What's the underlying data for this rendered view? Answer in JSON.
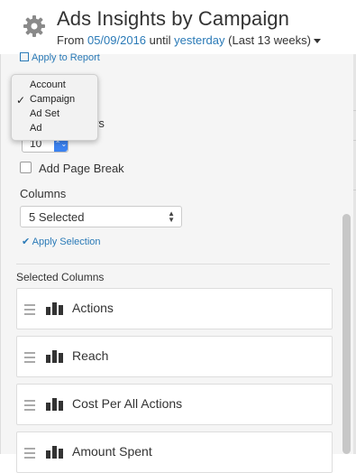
{
  "header": {
    "title": "Ads Insights by Campaign",
    "range_prefix": "From",
    "start_date": "05/09/2016",
    "until_text": "until",
    "end_text": "yesterday",
    "period_text": "(Last 13 weeks)",
    "icon": "gear-icon"
  },
  "panel": {
    "apply_report_label": "Apply to Report",
    "clipped_label": "ws",
    "rows_value": "10",
    "page_break_label": "Add Page Break",
    "columns_label": "Columns",
    "columns_selected": "5 Selected",
    "apply_selection_label": "Apply Selection",
    "selected_columns_title": "Selected Columns",
    "selected_columns": [
      {
        "name": "Actions"
      },
      {
        "name": "Reach"
      },
      {
        "name": "Cost Per All Actions"
      },
      {
        "name": "Amount Spent"
      }
    ]
  },
  "level_menu": {
    "options": [
      "Account",
      "Campaign",
      "Ad Set",
      "Ad"
    ],
    "selected": "Campaign"
  },
  "colors": {
    "link": "#2a7ab7",
    "stepper": "#3b82f0",
    "panel_bg": "#f5f5f5"
  }
}
